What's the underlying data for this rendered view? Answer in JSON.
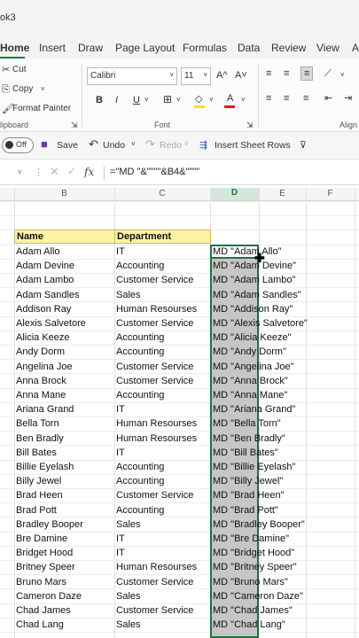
{
  "title_fragment": "ok3",
  "tabs": [
    "Home",
    "Insert",
    "Draw",
    "Page Layout",
    "Formulas",
    "Data",
    "Review",
    "View",
    "A"
  ],
  "ribbon": {
    "cut": "Cut",
    "copy": "Copy",
    "format_painter": "Format Painter",
    "clipboard_group": "lipboard",
    "font_name": "Calibri",
    "font_size": "11",
    "font_group": "Font",
    "align_group": "Align",
    "bold": "B",
    "italic": "I",
    "underline": "U",
    "grow_font": "A^",
    "shrink_font": "A˅"
  },
  "quickbar": {
    "autosave": "Off",
    "save": "Save",
    "undo": "Undo",
    "redo": "Redo",
    "insert_rows": "Insert Sheet Rows"
  },
  "formula": "=\"MD \"&\"\"\"\"&B4&\"\"\"\"",
  "columns": [
    "B",
    "C",
    "D",
    "E",
    "F"
  ],
  "headers": {
    "name": "Name",
    "department": "Department"
  },
  "rows": [
    [
      "Adam Allo",
      "IT",
      "MD \"Adam Allo\""
    ],
    [
      "Adam Devine",
      "Accounting",
      "MD \"Adam Devine\""
    ],
    [
      "Adam Lambo",
      "Customer Service",
      "MD \"Adam Lambo\""
    ],
    [
      "Adam Sandles",
      "Sales",
      "MD \"Adam Sandles\""
    ],
    [
      "Addison Ray",
      "Human Resourses",
      "MD \"Addison Ray\""
    ],
    [
      "Alexis Salvetore",
      "Customer Service",
      "MD \"Alexis Salvetore\""
    ],
    [
      "Alicia Keeze",
      "Accounting",
      "MD \"Alicia Keeze\""
    ],
    [
      "Andy Dorm",
      "Accounting",
      "MD \"Andy Dorm\""
    ],
    [
      "Angelina Joe",
      "Customer Service",
      "MD \"Angelina Joe\""
    ],
    [
      "Anna Brock",
      "Customer Service",
      "MD \"Anna Brock\""
    ],
    [
      "Anna Mane",
      "Accounting",
      "MD \"Anna Mane\""
    ],
    [
      "Ariana Grand",
      "IT",
      "MD \"Ariana Grand\""
    ],
    [
      "Bella Torn",
      "Human Resourses",
      "MD \"Bella Torn\""
    ],
    [
      "Ben Bradly",
      "Human Resourses",
      "MD \"Ben Bradly\""
    ],
    [
      "Bill Bates",
      "IT",
      "MD \"Bill Bates\""
    ],
    [
      "Billie Eyelash",
      "Accounting",
      "MD \"Billie Eyelash\""
    ],
    [
      "Billy Jewel",
      "Accounting",
      "MD \"Billy Jewel\""
    ],
    [
      "Brad Heen",
      "Customer Service",
      "MD \"Brad Heen\""
    ],
    [
      "Brad Pott",
      "Accounting",
      "MD \"Brad Pott\""
    ],
    [
      "Bradley Booper",
      "Sales",
      "MD \"Bradley Booper\""
    ],
    [
      "Bre Damine",
      "IT",
      "MD \"Bre Damine\""
    ],
    [
      "Bridget Hood",
      "IT",
      "MD \"Bridget Hood\""
    ],
    [
      "Britney Speer",
      "Human Resourses",
      "MD \"Britney Speer\""
    ],
    [
      "Bruno Mars",
      "Customer Service",
      "MD \"Bruno Mars\""
    ],
    [
      "Cameron Daze",
      "Sales",
      "MD \"Cameron Daze\""
    ],
    [
      "Chad James",
      "Customer Service",
      "MD \"Chad James\""
    ],
    [
      "Chad Lang",
      "Sales",
      "MD \"Chad Lang\""
    ]
  ]
}
